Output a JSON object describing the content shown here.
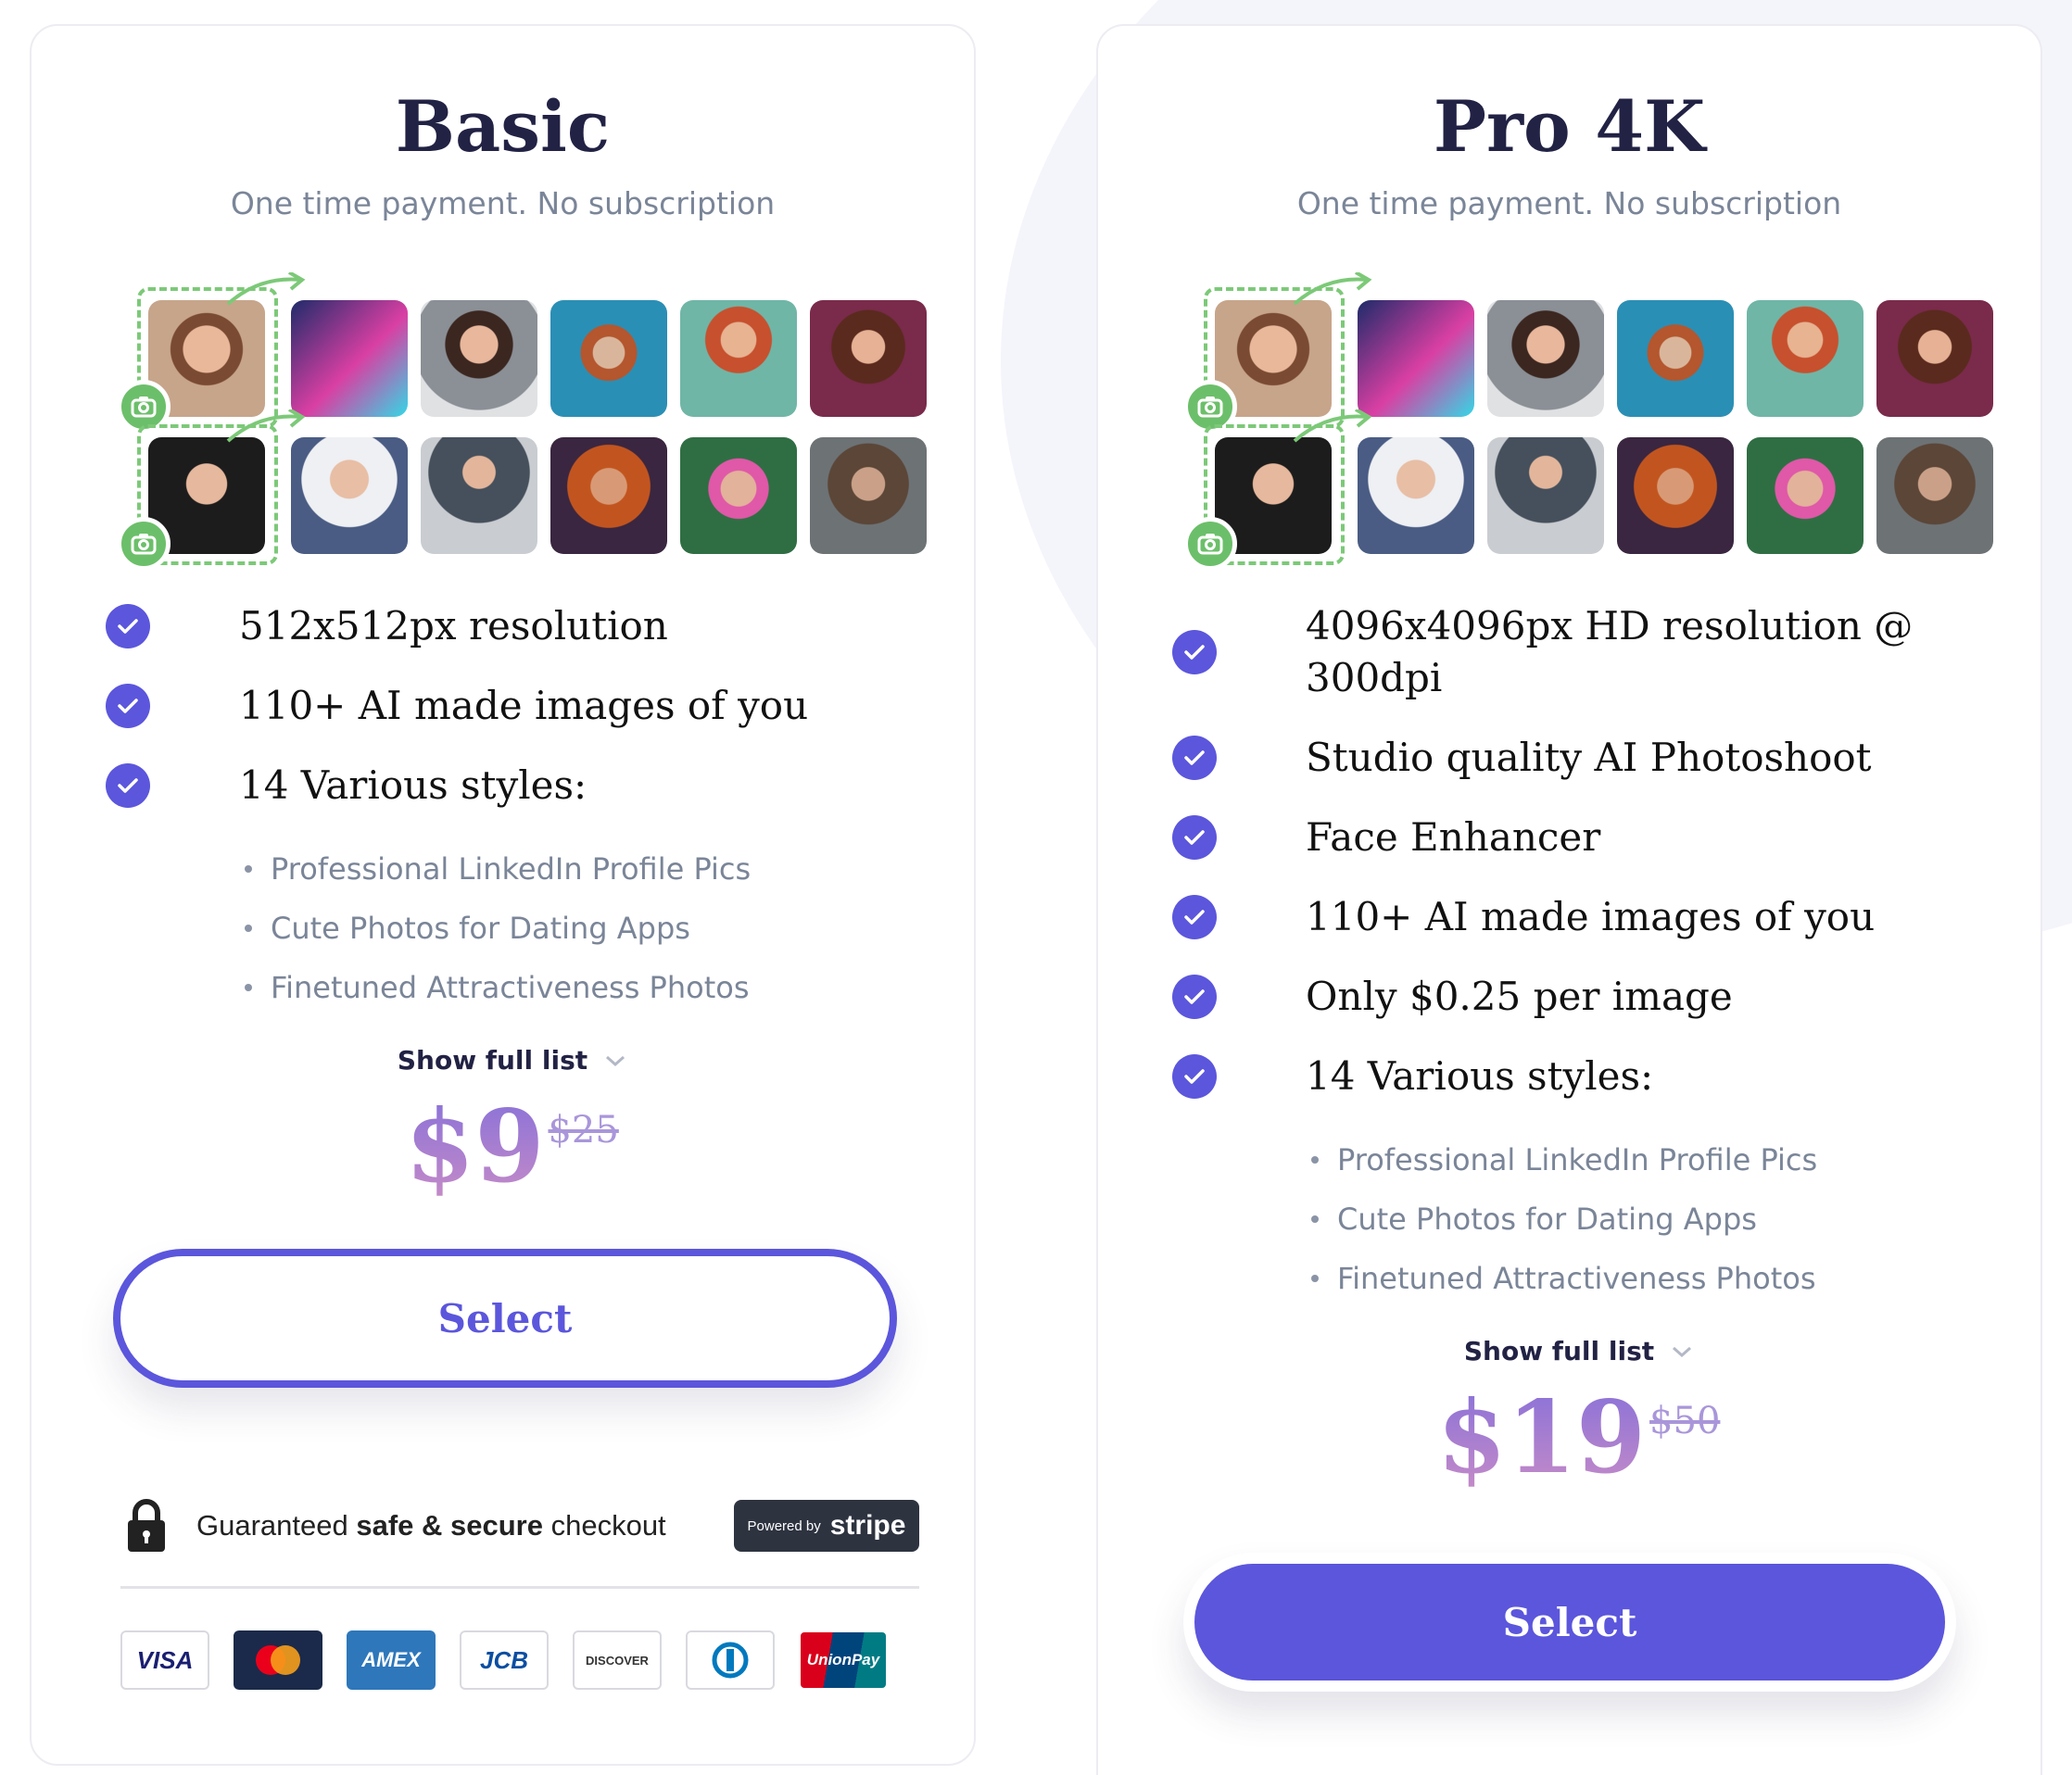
{
  "colors": {
    "accent": "#5b56dc",
    "heading": "#222245",
    "muted": "#7a8598",
    "camera_green": "#6cbf6a",
    "price_gradient_top": "#8a72d8",
    "price_gradient_bottom": "#c48ac8"
  },
  "basic": {
    "title": "Basic",
    "subtitle": "One time payment. No subscription",
    "features": [
      "512x512px resolution",
      "110+ AI made images of you",
      "14 Various styles:"
    ],
    "style_bullets": [
      "Professional LinkedIn Profile Pics",
      "Cute Photos for Dating Apps",
      "Finetuned Attractiveness Photos"
    ],
    "show_full_list": "Show full list",
    "price": "$9",
    "old_price": "$25",
    "select_label": "Select",
    "secure_prefix": "Guaranteed ",
    "secure_bold": "safe & secure",
    "secure_suffix": " checkout",
    "stripe_powered": "Powered by",
    "stripe_word": "stripe",
    "payment_cards": [
      "VISA",
      "mastercard",
      "AMEX",
      "JCB",
      "DISCOVER",
      "diners",
      "UnionPay"
    ]
  },
  "pro": {
    "title": "Pro 4K",
    "subtitle": "One time payment. No subscription",
    "features": [
      "4096x4096px HD resolution @ 300dpi",
      "Studio quality AI Photoshoot",
      "Face Enhancer",
      "110+ AI made images of you",
      "Only $0.25 per image",
      "14 Various styles:"
    ],
    "style_bullets": [
      "Professional LinkedIn Profile Pics",
      "Cute Photos for Dating Apps",
      "Finetuned Attractiveness Photos"
    ],
    "show_full_list": "Show full list",
    "price": "$19",
    "old_price": "$50",
    "select_label": "Select"
  },
  "image_grid": {
    "row1": [
      "source-woman-photo",
      "neon-cyber-woman",
      "business-woman-portrait",
      "underwater-woman",
      "fantasy-redhead-woman",
      "warrior-princess-woman"
    ],
    "row2": [
      "source-man-photo",
      "astronaut-man",
      "business-man-portrait",
      "cosmic-hooded-man",
      "punk-mohawk-man",
      "viking-man"
    ],
    "icons": [
      "camera-icon",
      "curved-arrow-icon",
      "check-icon",
      "chevron-down-icon",
      "lock-icon"
    ]
  }
}
